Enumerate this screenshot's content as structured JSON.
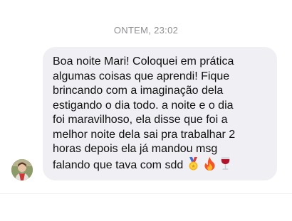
{
  "conversation": {
    "timestamp": "ONTEM, 23:02"
  },
  "message": {
    "sender_avatar": "avatar-photo",
    "text": "Boa noite Mari! Coloquei em prática\nalgumas coisas que aprendi! Fique\nbrincando com a imaginação dela\nestigando o dia todo. a noite e o dia\nfoi maravilhoso, ela disse que foi a\nmelhor noite dela sai pra trabalhar 2\nhoras depois ela já mandou msg\nfalando que tava com sdd",
    "emojis": [
      "medal-icon",
      "fire-icon",
      "wine-glass-icon"
    ],
    "bubble_color": "#efeff4",
    "text_color": "#111111"
  },
  "colors": {
    "timestamp": "#8e8e93",
    "background": "#ffffff"
  }
}
